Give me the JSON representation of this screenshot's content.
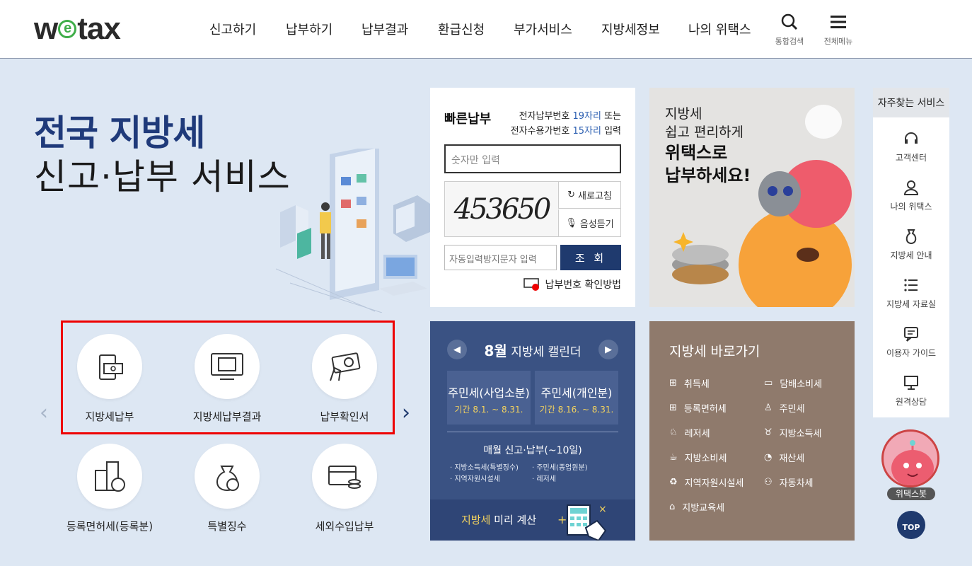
{
  "header": {
    "logo": "wetax",
    "nav": [
      "신고하기",
      "납부하기",
      "납부결과",
      "환급신청",
      "부가서비스",
      "지방세정보",
      "나의 위택스"
    ],
    "search_label": "통합검색",
    "menu_label": "전체메뉴"
  },
  "hero": {
    "line1": "전국 지방세",
    "line2": "신고·납부 서비스"
  },
  "services": [
    {
      "label": "지방세납부",
      "icon": "tax-payment-icon"
    },
    {
      "label": "지방세납부결과",
      "icon": "payment-result-icon"
    },
    {
      "label": "납부확인서",
      "icon": "payment-certificate-icon"
    },
    {
      "label": "등록면허세(등록분)",
      "icon": "registration-tax-icon"
    },
    {
      "label": "특별징수",
      "icon": "special-collection-icon"
    },
    {
      "label": "세외수입납부",
      "icon": "non-tax-revenue-icon"
    }
  ],
  "quick_pay": {
    "title": "빠른납부",
    "desc_line1_pre": "전자납부번호 ",
    "desc_line1_num": "19자리",
    "desc_line1_post": " 또는",
    "desc_line2_pre": "전자수용가번호 ",
    "desc_line2_num": "15자리",
    "desc_line2_post": " 입력",
    "input_placeholder": "숫자만 입력",
    "captcha_text": "453650",
    "refresh_label": "새로고침",
    "audio_label": "음성듣기",
    "auto_placeholder": "자동입력방지문자 입력",
    "search_button": "조 회",
    "help_link": "납부번호 확인방법"
  },
  "promo": {
    "line1": "지방세",
    "line2": "쉽고 편리하게",
    "line3": "위택스로",
    "line4": "납부하세요!"
  },
  "calendar": {
    "month": "8월",
    "title": "지방세 캘린더",
    "boxes": [
      {
        "name": "주민세(사업소분)",
        "period": "기간 8.1. ~ 8.31."
      },
      {
        "name": "주민세(개인분)",
        "period": "기간 8.16. ~ 8.31."
      }
    ],
    "monthly": "매월 신고·납부(~10일)",
    "items_left": [
      "지방소득세(특별징수)",
      "지역자원시설세"
    ],
    "items_right": [
      "주민세(종업원분)",
      "레저세"
    ],
    "footer_highlight": "지방세",
    "footer_text": " 미리 계산"
  },
  "shortcut": {
    "title": "지방세 바로가기",
    "left": [
      "취득세",
      "등록면허세",
      "레저세",
      "지방소비세",
      "지역자원시설세",
      "지방교육세"
    ],
    "right": [
      "담배소비세",
      "주민세",
      "지방소득세",
      "재산세",
      "자동차세"
    ]
  },
  "side": {
    "title": "자주찾는 서비스",
    "items": [
      "고객센터",
      "나의 위택스",
      "지방세 안내",
      "지방세 자료실",
      "이용자 가이드",
      "원격상담"
    ],
    "bot_label": "위택스봇",
    "top_label": "TOP"
  },
  "colors": {
    "navy": "#1f3a6e",
    "brand_green": "#3fae49",
    "shortcut_bg": "#8f7a6c",
    "calendar_bg": "#3a5283"
  }
}
